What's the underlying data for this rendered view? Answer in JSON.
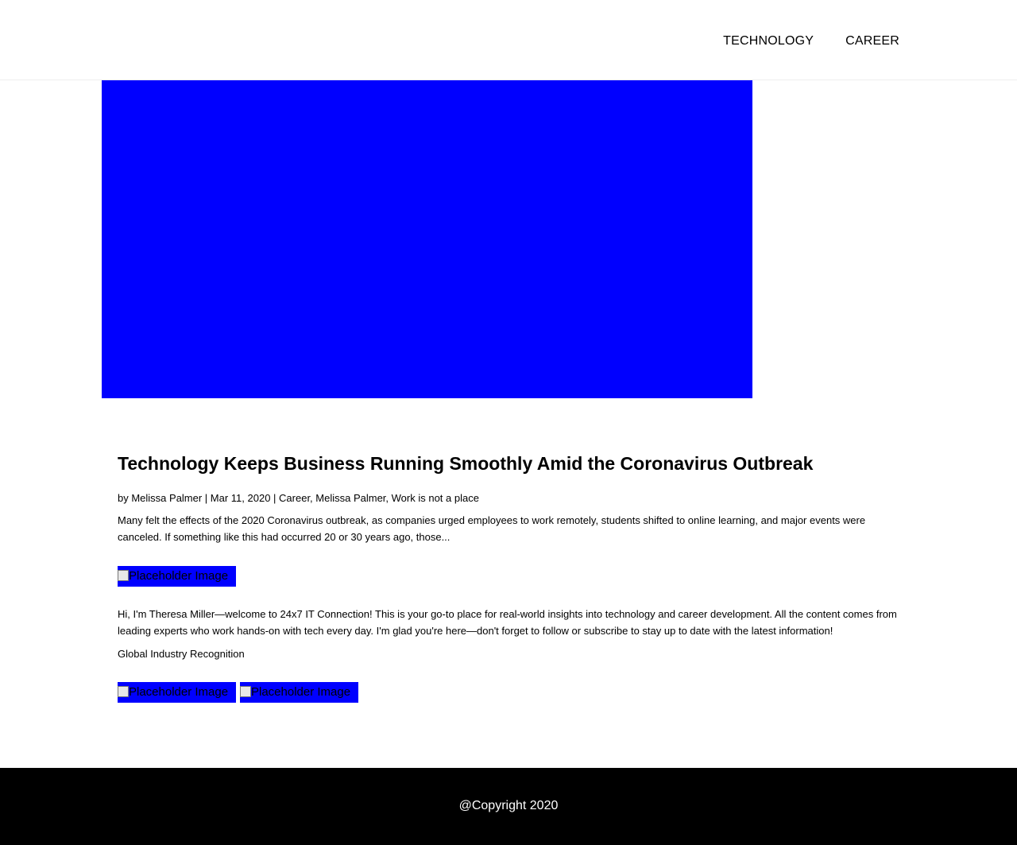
{
  "header": {
    "nav": [
      {
        "label": "TECHNOLOGY"
      },
      {
        "label": "CAREER"
      }
    ]
  },
  "hero": {
    "color": "#0000ff"
  },
  "post": {
    "title": "Technology Keeps Business Running Smoothly Amid the Coronavirus Outbreak",
    "meta": "by Melissa Palmer | Mar 11, 2020 | Career, Melissa Palmer, Work is not a place",
    "excerpt": "Many felt the effects of the 2020 Coronavirus outbreak, as companies urged employees to work remotely, students shifted to online learning, and major events were canceled. If something like this had occurred 20 or 30 years ago, those..."
  },
  "images": {
    "alt": "Placeholder Image",
    "broken_icon": "broken-image-icon"
  },
  "about": {
    "text": "Hi, I'm Theresa Miller—welcome to 24x7 IT Connection! This is your go-to place for real-world insights into technology and career development. All the content comes from leading experts who work hands-on with tech every day. I'm glad you're here—don't forget to follow or subscribe to stay up to date with the latest information!",
    "recognition": "Global Industry Recognition"
  },
  "footer": {
    "copyright": "@Copyright 2020"
  }
}
